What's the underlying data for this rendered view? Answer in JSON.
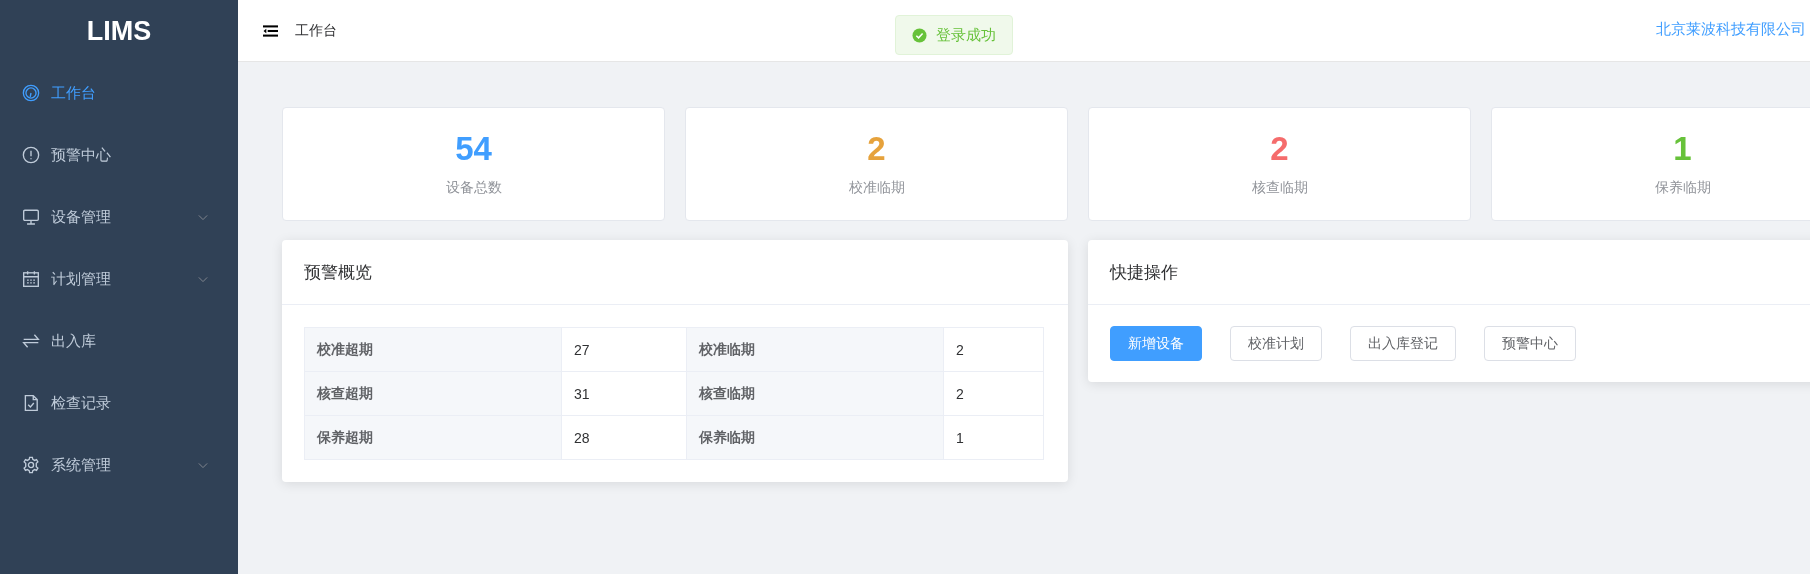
{
  "sidebar": {
    "logo": "LIMS",
    "items": [
      {
        "label": "工作台",
        "selected": true,
        "has_submenu": false
      },
      {
        "label": "预警中心",
        "selected": false,
        "has_submenu": false
      },
      {
        "label": "设备管理",
        "selected": false,
        "has_submenu": true
      },
      {
        "label": "计划管理",
        "selected": false,
        "has_submenu": true
      },
      {
        "label": "出入库",
        "selected": false,
        "has_submenu": false
      },
      {
        "label": "检查记录",
        "selected": false,
        "has_submenu": false
      },
      {
        "label": "系统管理",
        "selected": false,
        "has_submenu": true
      }
    ]
  },
  "header": {
    "breadcrumb": "工作台",
    "toast": "登录成功",
    "company": "北京莱波科技有限公司"
  },
  "stats": [
    {
      "value": "54",
      "label": "设备总数",
      "color": "#409eff"
    },
    {
      "value": "2",
      "label": "校准临期",
      "color": "#e6a23c"
    },
    {
      "value": "2",
      "label": "核查临期",
      "color": "#f56c6c"
    },
    {
      "value": "1",
      "label": "保养临期",
      "color": "#67c23a"
    }
  ],
  "warning_overview": {
    "title": "预警概览",
    "rows": [
      [
        "校准超期",
        "27",
        "校准临期",
        "2"
      ],
      [
        "核查超期",
        "31",
        "核查临期",
        "2"
      ],
      [
        "保养超期",
        "28",
        "保养临期",
        "1"
      ]
    ]
  },
  "quick_actions": {
    "title": "快捷操作",
    "buttons": [
      {
        "label": "新增设备",
        "kind": "primary"
      },
      {
        "label": "校准计划",
        "kind": "plain"
      },
      {
        "label": "出入库登记",
        "kind": "plain"
      },
      {
        "label": "预警中心",
        "kind": "plain"
      }
    ]
  }
}
